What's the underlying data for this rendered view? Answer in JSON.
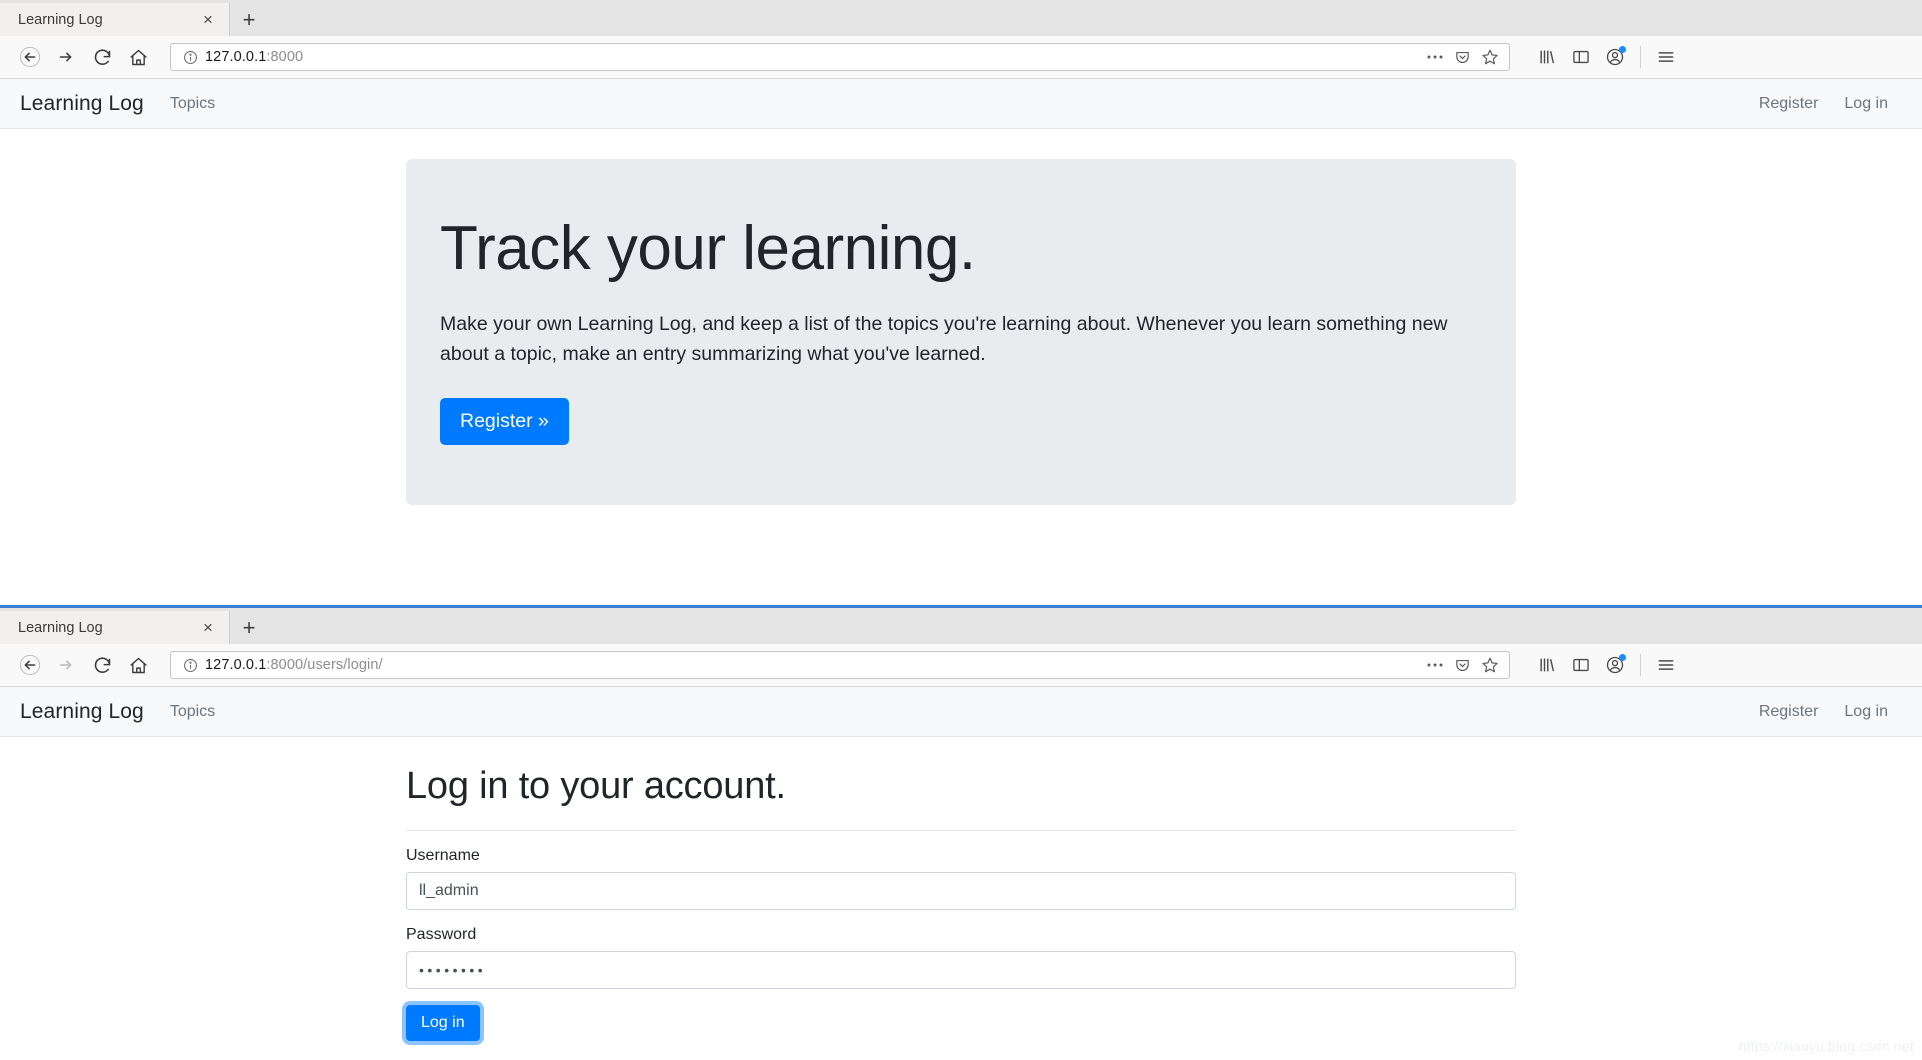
{
  "windows": [
    {
      "tab": {
        "title": "Learning Log",
        "close_label": "×",
        "newtab_label": "+"
      },
      "address": {
        "host": "127.0.0.1",
        "rest": ":8000",
        "info_icon": "info-circle-icon"
      },
      "toolbar": {
        "back": "back-arrow-icon",
        "forward": "forward-arrow-icon",
        "reload": "reload-icon",
        "home": "home-icon",
        "page_actions": "ellipsis-icon",
        "pocket": "pocket-icon",
        "bookmark": "star-icon",
        "library": "library-icon",
        "sidebar": "sidebar-icon",
        "account": "account-icon",
        "menu": "hamburger-menu-icon"
      },
      "site_nav": {
        "brand": "Learning Log",
        "links": [
          "Topics"
        ],
        "right_links": [
          "Register",
          "Log in"
        ]
      },
      "hero": {
        "title": "Track your learning.",
        "lead": "Make your own Learning Log, and keep a list of the topics you're learning about. Whenever you learn something new about a topic, make an entry summarizing what you've learned.",
        "cta_label": "Register »",
        "bg_color": "#e9ecef",
        "cta_color": "#007bff"
      }
    },
    {
      "tab": {
        "title": "Learning Log",
        "close_label": "×",
        "newtab_label": "+"
      },
      "address": {
        "host": "127.0.0.1",
        "rest": ":8000/users/login/",
        "info_icon": "info-circle-icon"
      },
      "toolbar": {
        "back": "back-arrow-icon",
        "forward": "forward-arrow-icon",
        "reload": "reload-icon",
        "home": "home-icon",
        "page_actions": "ellipsis-icon",
        "pocket": "pocket-icon",
        "bookmark": "star-icon",
        "library": "library-icon",
        "sidebar": "sidebar-icon",
        "account": "account-icon",
        "menu": "hamburger-menu-icon"
      },
      "site_nav": {
        "brand": "Learning Log",
        "links": [
          "Topics"
        ],
        "right_links": [
          "Register",
          "Log in"
        ]
      },
      "login": {
        "title": "Log in to your account.",
        "username_label": "Username",
        "username_value": "ll_admin",
        "password_label": "Password",
        "password_value": "••••••••",
        "submit_label": "Log in",
        "submit_color": "#007bff"
      }
    }
  ],
  "watermark": "https://xiaoyu.blog.csdn.net"
}
